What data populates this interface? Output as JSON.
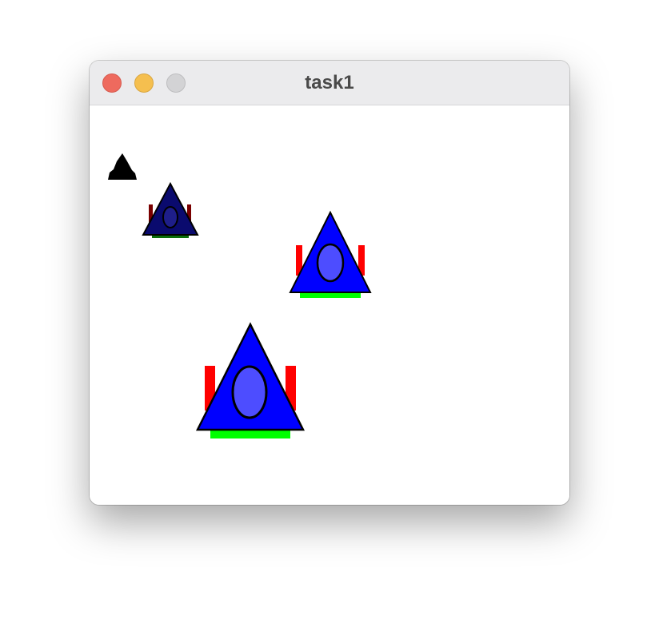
{
  "window": {
    "title": "task1",
    "buttons": [
      "close",
      "minimize",
      "maximize"
    ]
  },
  "canvas": {
    "background": "#ffffff",
    "colors": {
      "hull": "#0000ff",
      "hull_dim": "#0a0a6e",
      "cockpit": "#4d4dff",
      "cockpit_dim": "#1e1e8a",
      "cannon": "#ff0000",
      "cannon_dim": "#7a0000",
      "thruster": "#00ff00",
      "outline": "#000000"
    },
    "icons": [
      "tiny-ship-icon",
      "dim-ship-icon",
      "medium-ship-icon",
      "large-ship-icon"
    ]
  }
}
